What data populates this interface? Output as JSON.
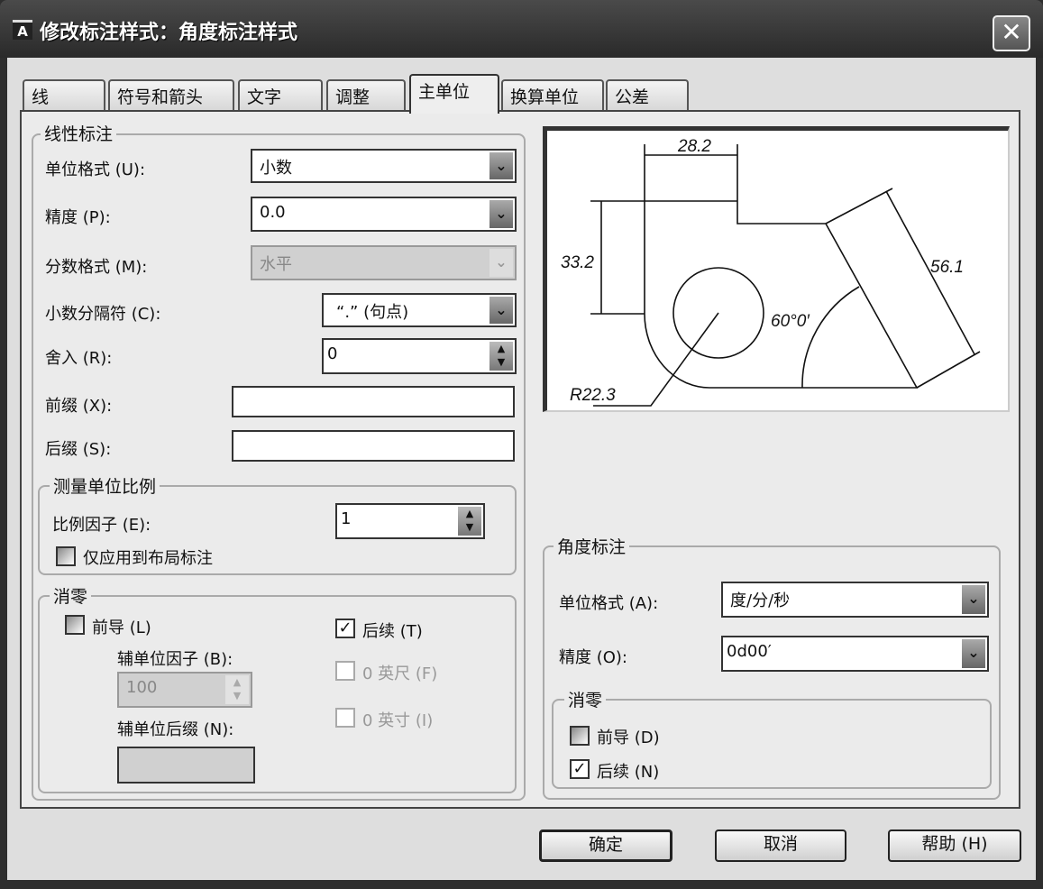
{
  "window": {
    "title": "修改标注样式：角度标注样式",
    "app_icon": "A",
    "close": "✕"
  },
  "tabs": [
    {
      "label": "线"
    },
    {
      "label": "符号和箭头"
    },
    {
      "label": "文字"
    },
    {
      "label": "调整"
    },
    {
      "label": "主单位",
      "active": true
    },
    {
      "label": "换算单位"
    },
    {
      "label": "公差"
    }
  ],
  "linear": {
    "group": "线性标注",
    "unit_format": {
      "label": "单位格式 (U):",
      "value": "小数"
    },
    "precision": {
      "label": "精度 (P):",
      "value": "0.0"
    },
    "fraction_format": {
      "label": "分数格式 (M):",
      "value": "水平",
      "disabled": true
    },
    "decimal_separator": {
      "label": "小数分隔符 (C):",
      "value": "“.”  (句点)"
    },
    "round_off": {
      "label": "舍入 (R):",
      "value": "0"
    },
    "prefix": {
      "label": "前缀 (X):",
      "value": ""
    },
    "suffix": {
      "label": "后缀 (S):",
      "value": ""
    },
    "scale": {
      "group": "测量单位比例",
      "factor_label": "比例因子 (E):",
      "factor_value": "1",
      "layout_only": {
        "label": "仅应用到布局标注",
        "checked": false
      }
    },
    "zero": {
      "group": "消零",
      "leading": {
        "label": "前导 (L)",
        "checked": false
      },
      "sub_factor_label": "辅单位因子 (B):",
      "sub_factor_value": "100",
      "sub_suffix_label": "辅单位后缀 (N):",
      "sub_suffix_value": "",
      "trailing": {
        "label": "后续 (T)",
        "checked": true
      },
      "feet": {
        "label": "0 英尺 (F)",
        "checked": false
      },
      "inches": {
        "label": "0 英寸 (I)",
        "checked": false
      }
    }
  },
  "preview": {
    "dims": [
      "28.2",
      "33.2",
      "56.1",
      "60°0′",
      "R22.3"
    ]
  },
  "angular": {
    "group": "角度标注",
    "unit_format": {
      "label": "单位格式 (A):",
      "value": "度/分/秒"
    },
    "precision": {
      "label": "精度 (O):",
      "value": "0d00′"
    },
    "zero": {
      "group": "消零",
      "leading": {
        "label": "前导 (D)",
        "checked": false
      },
      "trailing": {
        "label": "后续 (N)",
        "checked": true
      }
    }
  },
  "buttons": {
    "ok": "确定",
    "cancel": "取消",
    "help": "帮助 (H)"
  },
  "glyphs": {
    "dropdown": "⌄",
    "spin_up": "▲",
    "spin_down": "▼",
    "check": "✓"
  }
}
